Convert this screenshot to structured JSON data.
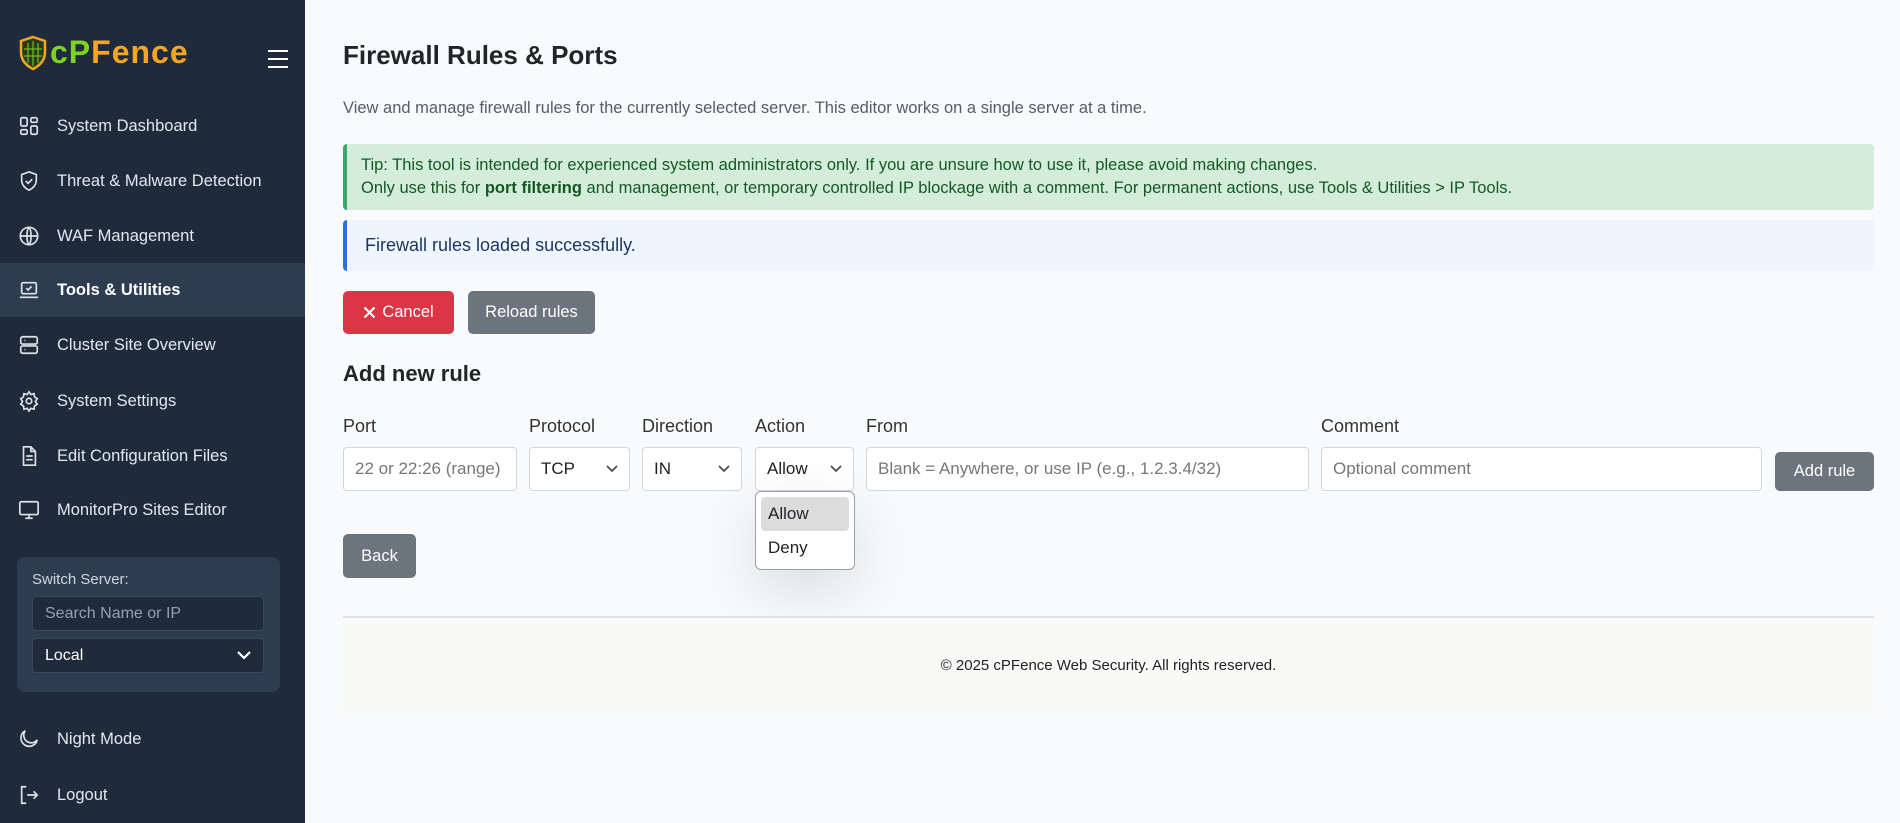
{
  "sidebar": {
    "logo_text": "cPFence",
    "items": [
      {
        "label": "System Dashboard",
        "icon": "dashboard-icon"
      },
      {
        "label": "Threat & Malware Detection",
        "icon": "shield-check-icon"
      },
      {
        "label": "WAF Management",
        "icon": "globe-icon"
      },
      {
        "label": "Tools & Utilities",
        "icon": "laptop-check-icon",
        "active": true
      },
      {
        "label": "Cluster Site Overview",
        "icon": "server-icon"
      },
      {
        "label": "System Settings",
        "icon": "gear-icon"
      },
      {
        "label": "Edit Configuration Files",
        "icon": "file-icon"
      },
      {
        "label": "MonitorPro Sites Editor",
        "icon": "monitor-icon"
      }
    ],
    "switch_server": {
      "label": "Switch Server:",
      "search_placeholder": "Search Name or IP",
      "selected": "Local"
    },
    "night_mode": "Night Mode",
    "logout": "Logout"
  },
  "main": {
    "title": "Firewall Rules & Ports",
    "description": "View and manage firewall rules for the currently selected server. This editor works on a single server at a time.",
    "tip": {
      "line1": "Tip: This tool is intended for experienced system administrators only. If you are unsure how to use it, please avoid making changes.",
      "line2_pre": "Only use this for ",
      "line2_bold": "port filtering",
      "line2_post": " and management, or temporary controlled IP blockage with a comment. For permanent actions, use Tools & Utilities > IP Tools."
    },
    "info": "Firewall rules loaded successfully.",
    "cancel_label": "Cancel",
    "reload_label": "Reload rules",
    "add_rule_heading": "Add new rule",
    "form": {
      "port_label": "Port",
      "port_placeholder": "22 or 22:26 (range)",
      "protocol_label": "Protocol",
      "protocol_value": "TCP",
      "direction_label": "Direction",
      "direction_value": "IN",
      "action_label": "Action",
      "action_value": "Allow",
      "action_options": [
        "Allow",
        "Deny"
      ],
      "from_label": "From",
      "from_placeholder": "Blank = Anywhere, or use IP (e.g., 1.2.3.4/32)",
      "comment_label": "Comment",
      "comment_placeholder": "Optional comment",
      "add_label": "Add rule"
    },
    "back_label": "Back",
    "footer": "© 2025 cPFence Web Security. All rights reserved."
  },
  "colors": {
    "sidebar": "#1f2a3b",
    "active": "#2e3c50",
    "danger": "#dc3545",
    "secondary": "#6c757d",
    "tip_bg": "#d4edda",
    "info_bg": "#eef5ff"
  }
}
